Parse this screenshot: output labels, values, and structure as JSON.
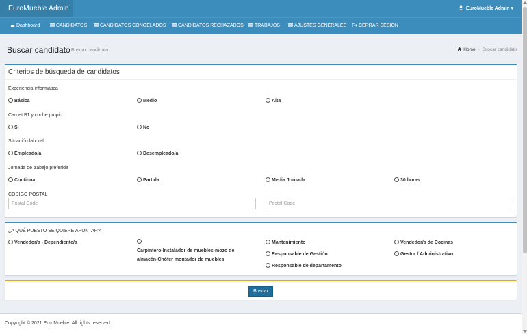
{
  "header": {
    "brand": "EuroMueble Admin",
    "user_name": "EuroMueble Admin",
    "user_caret": "▾"
  },
  "nav": {
    "items": [
      {
        "label": "Dashboard",
        "icon": "dashboard-icon"
      },
      {
        "label": "CANDIDATOS",
        "icon": "list-icon"
      },
      {
        "label": "CANDIDATOS CONGELADOS",
        "icon": "list-icon"
      },
      {
        "label": "CANDIDATOS RECHAZADOS",
        "icon": "list-icon"
      },
      {
        "label": "TRABAJOS",
        "icon": "list-icon"
      },
      {
        "label": "AJUSTES GENERALES",
        "icon": "list-icon"
      },
      {
        "label": "CERRAR SESION",
        "icon": "logout-icon"
      }
    ]
  },
  "page": {
    "title": "Buscar candidato",
    "subtitle": "Buscar candidato",
    "breadcrumb": {
      "home": "Home",
      "current": "Buscar candidato"
    }
  },
  "criteria": {
    "title": "Criterios de búsqueda de candidatos",
    "experience": {
      "label": "Experiencia informática",
      "options": [
        "Básica",
        "Medio",
        "Alta"
      ]
    },
    "license": {
      "label": "Carnet B1 y coche propio",
      "options": [
        "Sí",
        "No"
      ]
    },
    "employment": {
      "label": "Situación laboral",
      "options": [
        "Empleado/a",
        "Desempleado/a"
      ]
    },
    "schedule": {
      "label": "Jornada de trabajo preferida",
      "options": [
        "Continua",
        "Partida",
        "Media Jornada",
        "30 horas"
      ]
    },
    "postal": {
      "label": "CODIGO POSTAL",
      "placeholder_1": "Postal Code",
      "placeholder_2": "Postal Code"
    }
  },
  "positions": {
    "label": "¿A QUÉ PUESTO SE QUIERE APUNTAR?",
    "options": [
      "Vendedor/a - Dependiente/a",
      "Carpintero-Instalador de muebles-mozo de almacén-Chófer montador de muebles",
      "Mantenimiento",
      "Vendedor/a de Cocinas",
      "Responsable de Gestión",
      "Gestor / Administrativo",
      "Responsable de departamento"
    ],
    "carpintero_line1": "Carpintero-Instalador de muebles-mozo de",
    "carpintero_line2": "almacén-Chófer montador de muebles"
  },
  "actions": {
    "search_label": "Buscar"
  },
  "footer": {
    "copyright": "Copyright © 2021 EuroMueble. All rights reserved."
  },
  "colors": {
    "primary": "#3c8dbc",
    "brand_dark": "#367fa9",
    "warning": "#f39c12",
    "button": "#1f6e9c"
  }
}
